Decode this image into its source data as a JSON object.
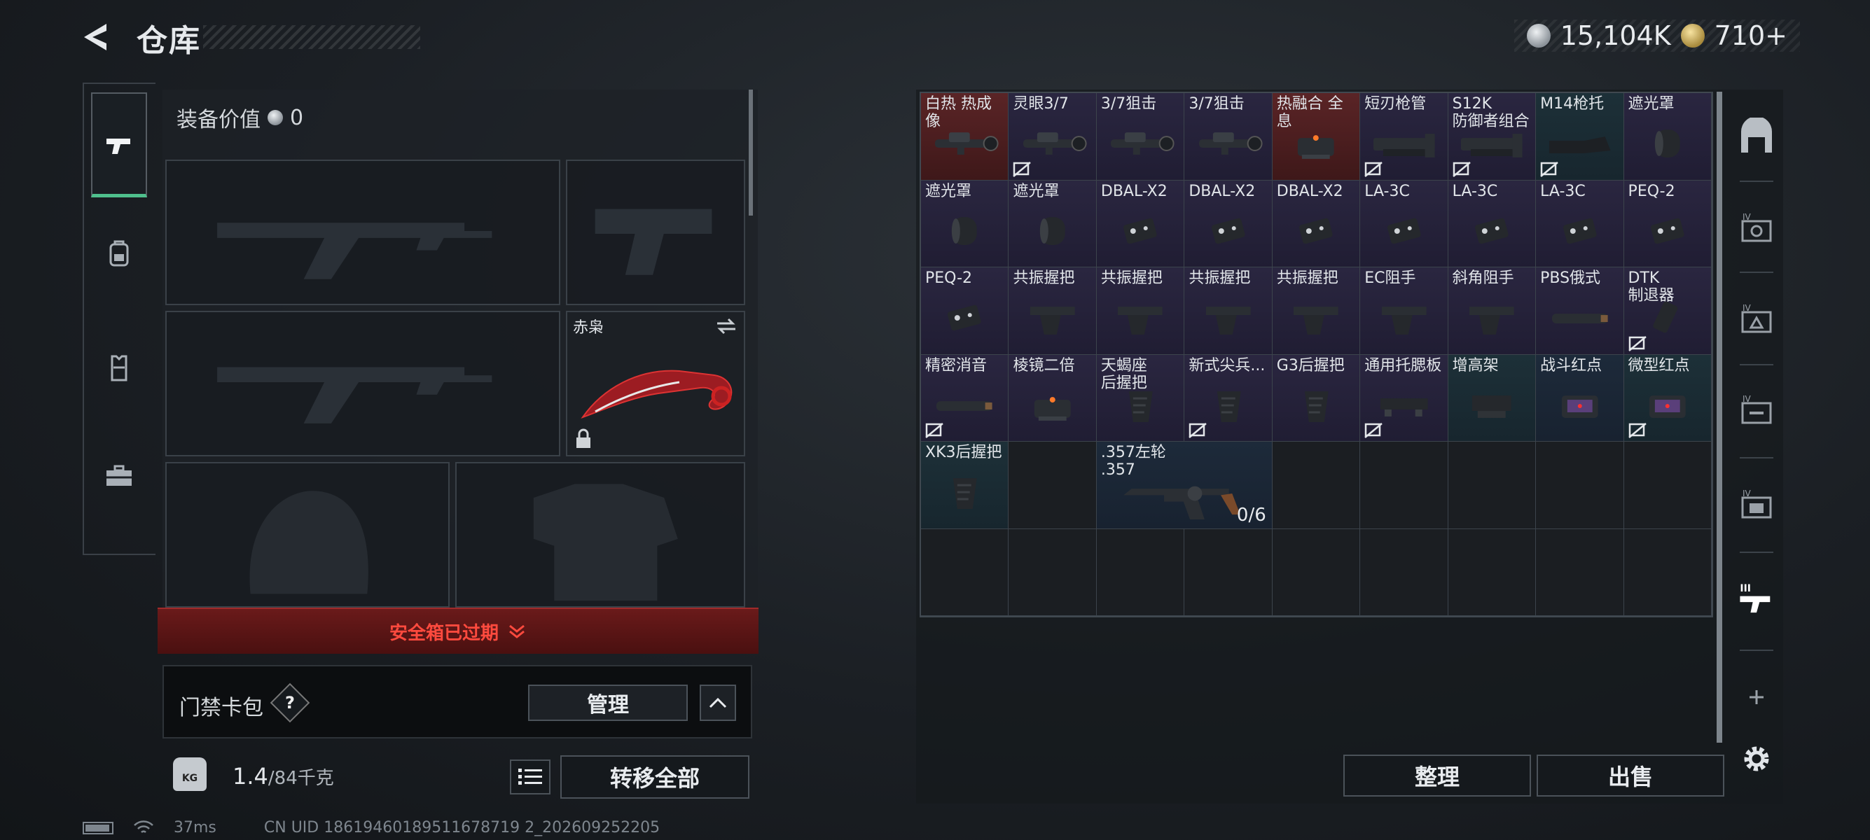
{
  "header": {
    "title": "仓库",
    "silver_amount": "15,104K",
    "gold_amount": "710+"
  },
  "left_nav": {
    "items": [
      "pistol-icon",
      "backpack-icon",
      "vest-icon",
      "toolbox-icon"
    ],
    "active": "pistol-icon"
  },
  "loadout": {
    "equip_value_label": "装备价值",
    "equip_value": "0",
    "melee_name": "赤枭",
    "safe_expired": "安全箱已过期",
    "keycard_label": "门禁卡包",
    "keycard_help": "?",
    "manage_label": "管理",
    "weight_current": "1.4",
    "weight_max": "/84千克",
    "weight_icon": "KG",
    "transfer_all_label": "转移全部"
  },
  "status": {
    "ping": "37ms",
    "uid": "CN UID 18619460189511678719 2_202609252205"
  },
  "storage": {
    "items": [
      {
        "label": "白热 热成像",
        "tint": "red",
        "icon": "scope",
        "nodrop": false
      },
      {
        "label": "灵眼3/7",
        "tint": "purple",
        "icon": "scope",
        "nodrop": true
      },
      {
        "label": "3/7狙击",
        "tint": "purple",
        "icon": "scope",
        "nodrop": false
      },
      {
        "label": "3/7狙击",
        "tint": "purple",
        "icon": "scope",
        "nodrop": false
      },
      {
        "label": "热融合 全息",
        "tint": "red",
        "icon": "sight",
        "nodrop": false
      },
      {
        "label": "短刃枪管",
        "tint": "purple",
        "icon": "barrel",
        "nodrop": true
      },
      {
        "label": "S12K\n防御者组合",
        "tint": "purple",
        "icon": "barrel",
        "nodrop": true
      },
      {
        "label": "M14枪托",
        "tint": "teal",
        "icon": "stock",
        "nodrop": true
      },
      {
        "label": "遮光罩",
        "tint": "purple",
        "icon": "hood",
        "nodrop": false
      },
      {
        "label": "遮光罩",
        "tint": "purple",
        "icon": "hood",
        "nodrop": false
      },
      {
        "label": "遮光罩",
        "tint": "purple",
        "icon": "hood",
        "nodrop": false
      },
      {
        "label": "DBAL-X2",
        "tint": "purple",
        "icon": "laser",
        "nodrop": false
      },
      {
        "label": "DBAL-X2",
        "tint": "purple",
        "icon": "laser",
        "nodrop": false
      },
      {
        "label": "DBAL-X2",
        "tint": "purple",
        "icon": "laser",
        "nodrop": false
      },
      {
        "label": "LA-3C",
        "tint": "purple",
        "icon": "laser",
        "nodrop": false
      },
      {
        "label": "LA-3C",
        "tint": "purple",
        "icon": "laser",
        "nodrop": false
      },
      {
        "label": "LA-3C",
        "tint": "purple",
        "icon": "laser",
        "nodrop": false
      },
      {
        "label": "PEQ-2",
        "tint": "purple",
        "icon": "laser",
        "nodrop": false
      },
      {
        "label": "PEQ-2",
        "tint": "purple",
        "icon": "laser",
        "nodrop": false
      },
      {
        "label": "共振握把",
        "tint": "purple",
        "icon": "grip",
        "nodrop": false
      },
      {
        "label": "共振握把",
        "tint": "purple",
        "icon": "grip",
        "nodrop": false
      },
      {
        "label": "共振握把",
        "tint": "purple",
        "icon": "grip",
        "nodrop": false
      },
      {
        "label": "共振握把",
        "tint": "purple",
        "icon": "grip",
        "nodrop": false
      },
      {
        "label": "EC阻手",
        "tint": "purple",
        "icon": "grip",
        "nodrop": false
      },
      {
        "label": "斜角阻手",
        "tint": "purple",
        "icon": "grip",
        "nodrop": false
      },
      {
        "label": "PBS俄式",
        "tint": "purple",
        "icon": "suppressor",
        "nodrop": false
      },
      {
        "label": "DTK\n制退器",
        "tint": "purple",
        "icon": "muzzle",
        "nodrop": true
      },
      {
        "label": "精密消音",
        "tint": "purple",
        "icon": "suppressor",
        "nodrop": true
      },
      {
        "label": "棱镜二倍",
        "tint": "purple",
        "icon": "sight",
        "nodrop": false
      },
      {
        "label": "天蝎座\n后握把",
        "tint": "purple",
        "icon": "pgrip",
        "nodrop": false
      },
      {
        "label": "新式尖兵...",
        "tint": "purple",
        "icon": "pgrip",
        "nodrop": true
      },
      {
        "label": "G3后握把",
        "tint": "purple",
        "icon": "pgrip",
        "nodrop": false
      },
      {
        "label": "通用托腮板",
        "tint": "purple",
        "icon": "cheek",
        "nodrop": true
      },
      {
        "label": "增高架",
        "tint": "teal",
        "icon": "mount",
        "nodrop": false
      },
      {
        "label": "战斗红点",
        "tint": "blue",
        "icon": "reddot",
        "nodrop": false
      },
      {
        "label": "微型红点",
        "tint": "teal",
        "icon": "reddot",
        "nodrop": true
      },
      {
        "label": "XK3后握把",
        "tint": "teal",
        "icon": "pgrip",
        "nodrop": false
      },
      {
        "label": "",
        "tint": "",
        "icon": "",
        "nodrop": false
      },
      {
        "label": ".357左轮\n.357",
        "tint": "blue",
        "icon": "revolver",
        "nodrop": false,
        "span": 2,
        "count": "0/6"
      }
    ]
  },
  "actions": {
    "sort_label": "整理",
    "sell_label": "出售"
  },
  "right_nav": {
    "items": [
      "armory-icon",
      "storage-iv-1-icon",
      "storage-iv-2-icon",
      "storage-iv-3-icon",
      "storage-iv-4-icon",
      "storage-iii-icon",
      "add-icon",
      "settings-icon"
    ],
    "active": "storage-iii-icon"
  },
  "colors": {
    "accent_green": "#4fc08d",
    "warning_red": "#ff4a3e",
    "banner_red": "#6a1a1a"
  }
}
